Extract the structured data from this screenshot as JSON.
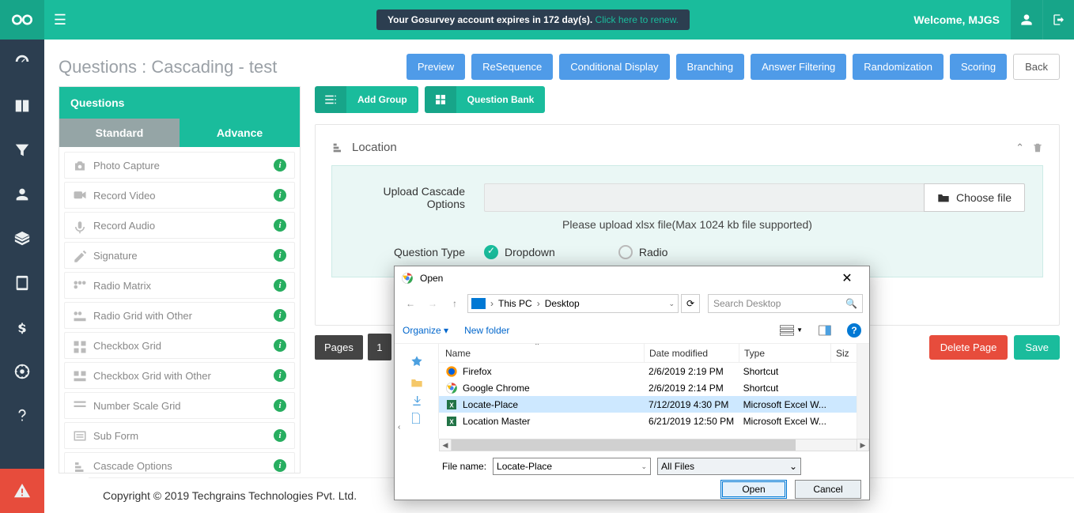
{
  "topbar": {
    "expiry_prefix": "Your Gosurvey account expires in 172 day(s). ",
    "renew_text": "Click here to renew.",
    "welcome": "Welcome, MJGS"
  },
  "page": {
    "title": "Questions : Cascading - test"
  },
  "header_buttons": {
    "preview": "Preview",
    "resequence": "ReSequence",
    "conditional": "Conditional Display",
    "branching": "Branching",
    "filtering": "Answer Filtering",
    "randomization": "Randomization",
    "scoring": "Scoring",
    "back": "Back"
  },
  "qpanel": {
    "header": "Questions",
    "tab_standard": "Standard",
    "tab_advance": "Advance",
    "items": [
      {
        "label": "Photo Capture"
      },
      {
        "label": "Record Video"
      },
      {
        "label": "Record Audio"
      },
      {
        "label": "Signature"
      },
      {
        "label": "Radio Matrix"
      },
      {
        "label": "Radio Grid with Other"
      },
      {
        "label": "Checkbox Grid"
      },
      {
        "label": "Checkbox Grid with Other"
      },
      {
        "label": "Number Scale Grid"
      },
      {
        "label": "Sub Form"
      },
      {
        "label": "Cascade Options"
      }
    ]
  },
  "editor_toolbar": {
    "add_group": "Add Group",
    "question_bank": "Question Bank"
  },
  "card": {
    "title": "Location",
    "upload_label": "Upload Cascade Options",
    "choose_file": "Choose file",
    "hint": "Please upload xlsx file(Max 1024 kb file supported)",
    "qtype_label": "Question Type",
    "opt_dropdown": "Dropdown",
    "opt_radio": "Radio"
  },
  "pages": {
    "label": "Pages",
    "page1": "1",
    "delete": "Delete Page",
    "save": "Save"
  },
  "footer": {
    "copyright": "Copyright © 2019 Techgrains Technologies Pvt. Ltd."
  },
  "dialog": {
    "title": "Open",
    "path_thispc": "This PC",
    "path_desktop": "Desktop",
    "search_placeholder": "Search Desktop",
    "organize": "Organize",
    "new_folder": "New folder",
    "col_name": "Name",
    "col_date": "Date modified",
    "col_type": "Type",
    "col_size": "Siz",
    "files": [
      {
        "name": "Firefox",
        "date": "2/6/2019 2:19 PM",
        "type": "Shortcut",
        "icon": "firefox"
      },
      {
        "name": "Google Chrome",
        "date": "2/6/2019 2:14 PM",
        "type": "Shortcut",
        "icon": "chrome"
      },
      {
        "name": "Locate-Place",
        "date": "7/12/2019 4:30 PM",
        "type": "Microsoft Excel W...",
        "icon": "excel",
        "selected": true
      },
      {
        "name": "Location Master",
        "date": "6/21/2019 12:50 PM",
        "type": "Microsoft Excel W...",
        "icon": "excel"
      }
    ],
    "filename_label": "File name:",
    "filename_value": "Locate-Place",
    "filter": "All Files",
    "open_btn": "Open",
    "cancel_btn": "Cancel"
  }
}
